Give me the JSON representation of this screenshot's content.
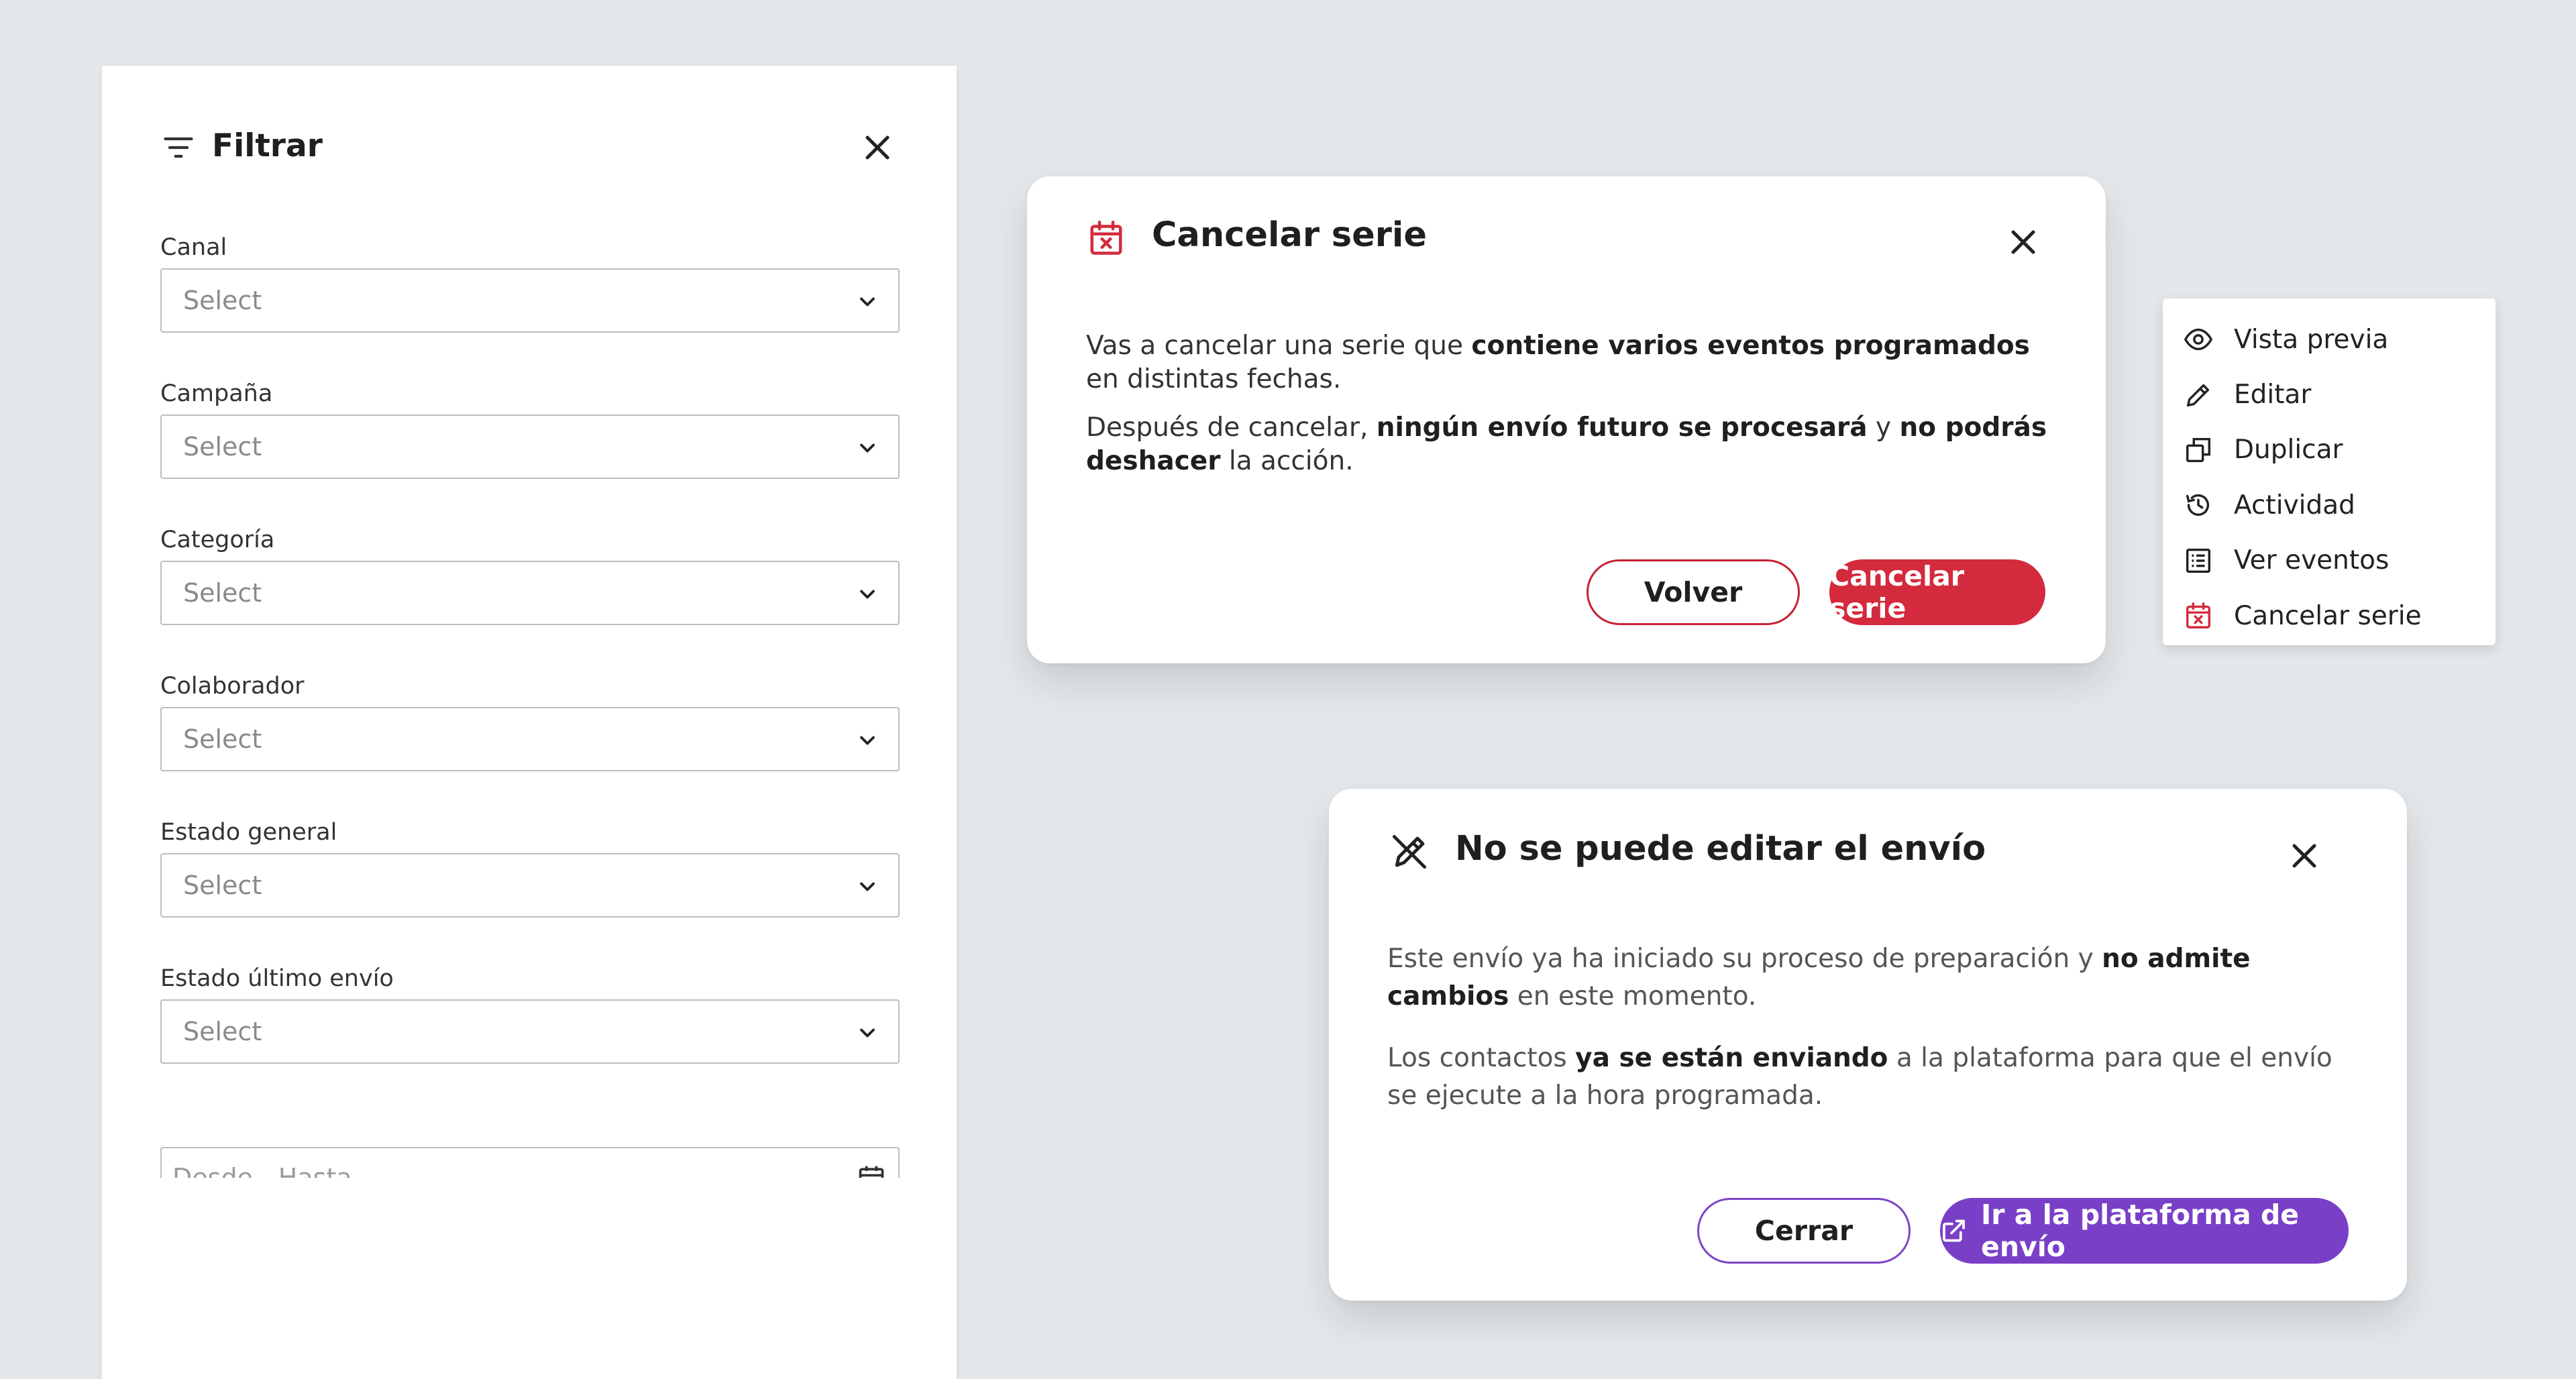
{
  "colors": {
    "background": "#e4e8eb",
    "danger": "#d42a3d",
    "purple": "#7a3fc7",
    "text": "#1f1f1f",
    "placeholder": "#8a8a8a"
  },
  "filter": {
    "title": "Filtrar",
    "title_icon": "filter-lines-icon",
    "close_icon": "close-icon",
    "fields": [
      {
        "label": "Canal",
        "value": "Select"
      },
      {
        "label": "Campaña",
        "value": "Select"
      },
      {
        "label": "Categoría",
        "value": "Select"
      },
      {
        "label": "Colaborador",
        "value": "Select"
      },
      {
        "label": "Estado general",
        "value": "Select"
      },
      {
        "label": "Estado último envío",
        "value": "Select"
      }
    ],
    "date_range": {
      "placeholder": "Desde - Hasta",
      "icon": "calendar-icon"
    }
  },
  "cancel_modal": {
    "title": "Cancelar serie",
    "title_icon": "calendar-x-icon",
    "p1_a": "Vas a cancelar una serie que ",
    "p1_b": "contiene varios eventos programados",
    "p1_c": " en distintas fechas.",
    "p2_a": "Después de cancelar, ",
    "p2_b": "ningún envío futuro se procesará",
    "p2_c": " y ",
    "p2_d": "no podrás deshacer",
    "p2_e": " la acción.",
    "secondary_button": "Volver",
    "primary_button": "Cancelar serie"
  },
  "context_menu": {
    "items": [
      {
        "label": "Vista previa",
        "icon": "eye-icon"
      },
      {
        "label": "Editar",
        "icon": "pencil-icon"
      },
      {
        "label": "Duplicar",
        "icon": "duplicate-icon"
      },
      {
        "label": "Actividad",
        "icon": "history-icon"
      },
      {
        "label": "Ver eventos",
        "icon": "list-icon"
      },
      {
        "label": "Cancelar serie",
        "icon": "calendar-x-icon"
      }
    ]
  },
  "edit_modal": {
    "title": "No se puede editar el envío",
    "title_icon": "pencil-off-icon",
    "p1_a": "Este envío ya ha iniciado su proceso de preparación y ",
    "p1_b": "no admite cambios",
    "p1_c": " en este momento.",
    "p2_a": "Los contactos ",
    "p2_b": "ya se están enviando",
    "p2_c": " a la plataforma para que el envío se ejecute a la hora programada.",
    "secondary_button": "Cerrar",
    "primary_button": "Ir a la plataforma de envío",
    "primary_icon": "external-link-icon"
  }
}
